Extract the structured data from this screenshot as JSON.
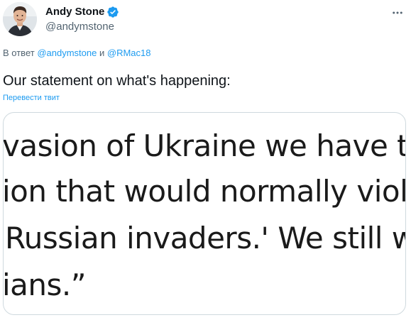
{
  "tweet": {
    "author": {
      "display_name": "Andy Stone",
      "handle": "@andymstone",
      "avatar_icon": "profile-photo",
      "verified_icon": "verified-badge-icon",
      "verified_color": "#1d9bf0"
    },
    "more_icon": "more-dots-icon",
    "reply": {
      "prefix": "В ответ",
      "mention_1": "@andymstone",
      "conjunction": "и",
      "mention_2": "@RMac18"
    },
    "text": "Our statement on what's happening:",
    "translate_label": "Перевести твит",
    "media": {
      "lines": [
        "vasion of Ukraine we have te",
        "ion that would normally viol",
        "Russian invaders.' We still w",
        "ians.”"
      ]
    }
  },
  "colors": {
    "text_primary": "#0f1419",
    "text_secondary": "#536471",
    "link": "#1d9bf0",
    "border": "#cfd9de"
  }
}
